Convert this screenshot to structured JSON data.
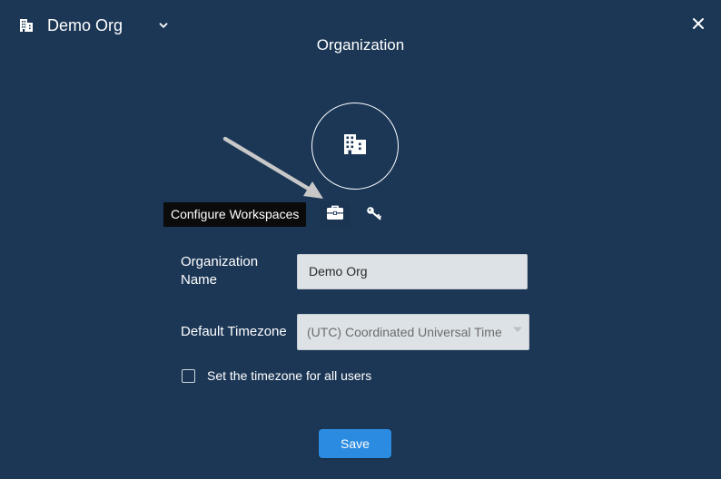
{
  "header": {
    "org_name": "Demo Org",
    "org_icon": "building-icon",
    "dropdown_icon": "chevron-down-icon",
    "close_icon": "close-icon",
    "title": "Organization"
  },
  "avatar": {
    "icon": "building-icon"
  },
  "tabs": {
    "tooltip": "Configure Workspaces",
    "items": [
      {
        "icon": "briefcase-icon",
        "active": true
      },
      {
        "icon": "key-icon",
        "active": false
      }
    ]
  },
  "form": {
    "org_name_label": "Organization Name",
    "org_name_value": "Demo Org",
    "timezone_label": "Default Timezone",
    "timezone_value": "(UTC) Coordinated Universal Time",
    "timezone_all_users_label": "Set the timezone for all users",
    "timezone_all_users_checked": false,
    "save_label": "Save"
  },
  "colors": {
    "background": "#1c3756",
    "field_background": "#dde2e6",
    "primary_button": "#2b8be0",
    "tooltip_background": "#0b0b0b",
    "annotation_arrow": "#c8c8c8"
  }
}
